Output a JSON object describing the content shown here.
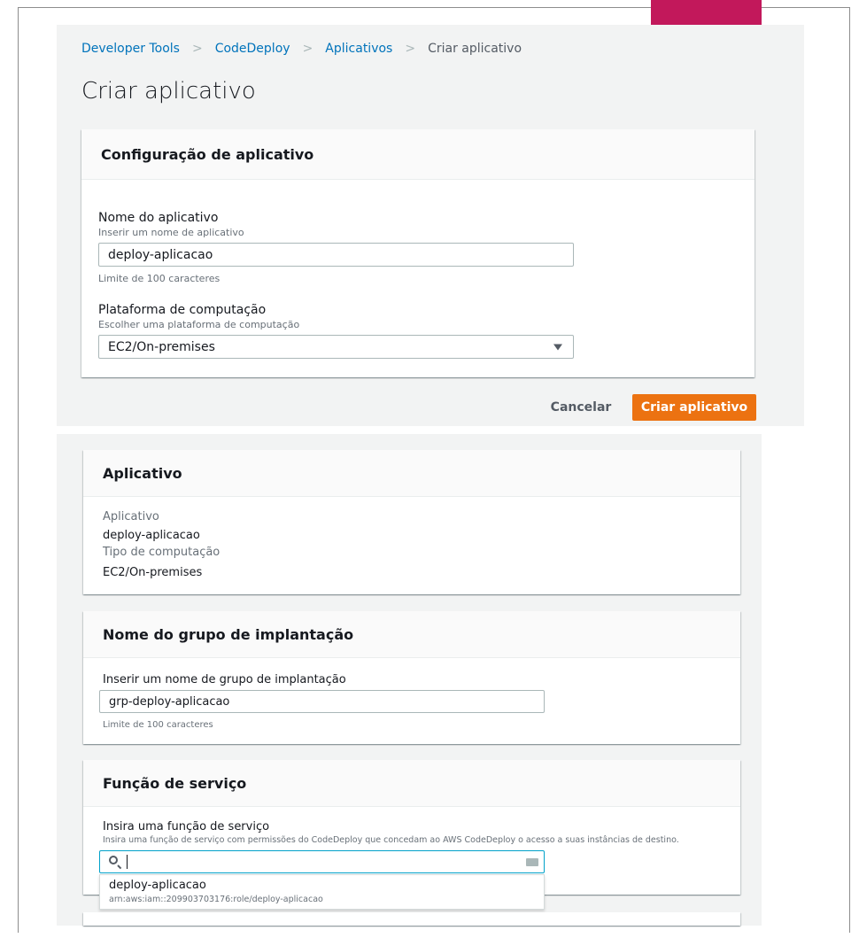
{
  "breadcrumb": {
    "items": [
      "Developer Tools",
      "CodeDeploy",
      "Aplicativos"
    ],
    "current": "Criar aplicativo"
  },
  "page_title": "Criar aplicativo",
  "app_config": {
    "header": "Configuração de aplicativo",
    "name_label": "Nome do aplicativo",
    "name_desc": "Inserir um nome de aplicativo",
    "name_value": "deploy-aplicacao",
    "name_hint": "Limite de 100 caracteres",
    "platform_label": "Plataforma de computação",
    "platform_desc": "Escolher uma plataforma de computação",
    "platform_value": "EC2/On-premises"
  },
  "actions": {
    "cancel": "Cancelar",
    "create": "Criar aplicativo"
  },
  "app_summary": {
    "header": "Aplicativo",
    "app_label": "Aplicativo",
    "app_value": "deploy-aplicacao",
    "compute_label": "Tipo de computação",
    "compute_value": "EC2/On-premises"
  },
  "deploy_group": {
    "header": "Nome do grupo de implantação",
    "label": "Inserir um nome de grupo de implantação",
    "value": "grp-deploy-aplicacao",
    "hint": "Limite de 100 caracteres"
  },
  "service_role": {
    "header": "Função de serviço",
    "label": "Insira uma função de serviço",
    "desc": "Insira uma função de serviço com permissões do CodeDeploy que concedam ao AWS CodeDeploy o acesso a suas instâncias de destino.",
    "search_value": "",
    "option_name": "deploy-aplicacao",
    "option_arn": "arn:aws:iam::209903703176:role/deploy-aplicacao"
  },
  "colors": {
    "link": "#0073bb",
    "primary": "#ec7211",
    "accent": "#c2185b",
    "focus": "#00a1c9"
  }
}
